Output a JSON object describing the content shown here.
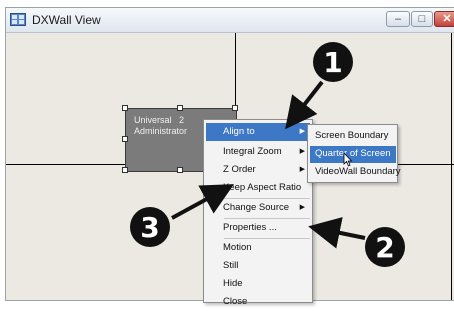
{
  "window": {
    "title": "DXWall View",
    "controls": {
      "minimize": "–",
      "maximize": "□",
      "close": "✕"
    }
  },
  "source_window": {
    "name": "Universal   2",
    "user": "Administrator"
  },
  "context_menu": {
    "items": [
      {
        "label": "Align to",
        "has_submenu": true,
        "highlighted": true
      },
      {
        "label": "Integral Zoom",
        "has_submenu": true
      },
      {
        "label": "Z Order",
        "has_submenu": true
      },
      {
        "label": "Keep Aspect Ratio",
        "has_submenu": false
      },
      {
        "label": "Change Source",
        "has_submenu": true
      },
      {
        "label": "Properties ...",
        "has_submenu": false
      },
      {
        "label": "Motion",
        "has_submenu": false
      },
      {
        "label": "Still",
        "has_submenu": false
      },
      {
        "label": "Hide",
        "has_submenu": false
      },
      {
        "label": "Close",
        "has_submenu": false
      }
    ],
    "submenu_arrow": "▶"
  },
  "submenu": {
    "items": [
      {
        "label": "Screen Boundary"
      },
      {
        "label": "Quarter of Screen",
        "highlighted": true
      },
      {
        "label": "VideoWall Boundary"
      }
    ]
  },
  "callouts": {
    "badge_1": "1",
    "badge_2": "2",
    "badge_3": "3"
  },
  "colors": {
    "menu_highlight": "#3c78c6",
    "canvas": "#ece9e3",
    "source_window": "#7b7b7b",
    "callout": "#111111"
  }
}
